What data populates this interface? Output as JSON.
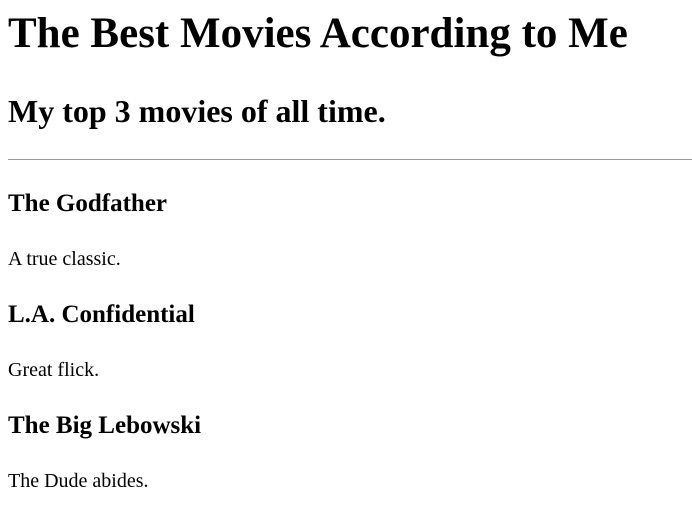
{
  "header": {
    "title": "The Best Movies According to Me",
    "subtitle": "My top 3 movies of all time."
  },
  "movies": [
    {
      "title": "The Godfather",
      "description": "A true classic."
    },
    {
      "title": "L.A. Confidential",
      "description": "Great flick."
    },
    {
      "title": "The Big Lebowski",
      "description": "The Dude abides."
    }
  ]
}
